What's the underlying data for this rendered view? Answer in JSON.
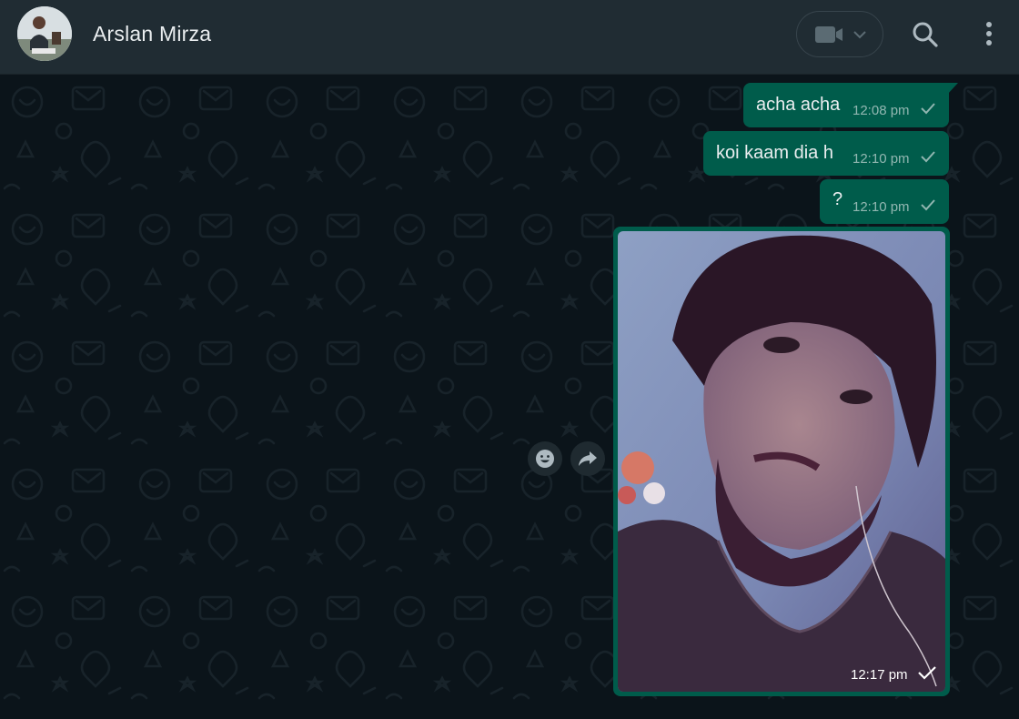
{
  "header": {
    "contact_name": "Arslan Mirza",
    "avatar_icon": "contact-avatar",
    "video_icon": "video-camera-icon",
    "search_icon": "search-icon",
    "menu_icon": "more-vertical-icon"
  },
  "messages": [
    {
      "text": "acha acha",
      "time": "12:08 pm",
      "status": "sent"
    },
    {
      "text": "koi kaam dia h",
      "time": "12:10 pm",
      "status": "sent"
    },
    {
      "text": "?",
      "time": "12:10 pm",
      "status": "sent"
    }
  ],
  "image_message": {
    "time": "12:17 pm",
    "status": "sent"
  },
  "hover_actions": {
    "react_icon": "emoji-icon",
    "forward_icon": "forward-icon"
  },
  "colors": {
    "header_bg": "#202c33",
    "chat_bg": "#0b141a",
    "outgoing_bubble": "#005c4b",
    "primary_text": "#e9edef",
    "icon": "#aebac1"
  }
}
